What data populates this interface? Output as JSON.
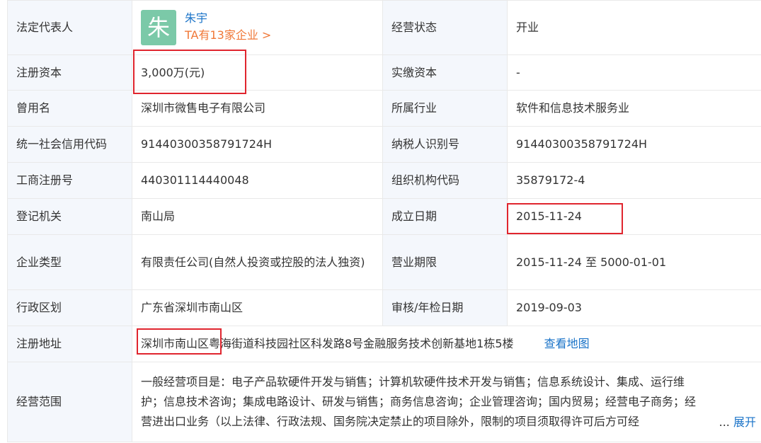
{
  "colors": {
    "label_bg": "#f4f7fc",
    "link_blue": "#1a73c8",
    "orange": "#f07838",
    "avatar_green": "#7bc9a8",
    "highlight_red": "#e0252e"
  },
  "rows": {
    "legal_rep": {
      "label": "法定代表人",
      "avatar_char": "朱",
      "name": "朱宇",
      "companies_link": "TA有13家企业 >"
    },
    "status": {
      "label": "经营状态",
      "value": "开业"
    },
    "reg_capital": {
      "label": "注册资本",
      "value": "3,000万(元)"
    },
    "paid_capital": {
      "label": "实缴资本",
      "value": "-"
    },
    "former_name": {
      "label": "曾用名",
      "value": "深圳市微售电子有限公司"
    },
    "industry": {
      "label": "所属行业",
      "value": "软件和信息技术服务业"
    },
    "credit_code": {
      "label": "统一社会信用代码",
      "value": "91440300358791724H"
    },
    "taxpayer_id": {
      "label": "纳税人识别号",
      "value": "91440300358791724H"
    },
    "biz_reg_no": {
      "label": "工商注册号",
      "value": "440301114440048"
    },
    "org_code": {
      "label": "组织机构代码",
      "value": "35879172-4"
    },
    "authority": {
      "label": "登记机关",
      "value": "南山局"
    },
    "founded": {
      "label": "成立日期",
      "value": "2015-11-24"
    },
    "company_type": {
      "label": "企业类型",
      "value": "有限责任公司(自然人投资或控股的法人独资)"
    },
    "term": {
      "label": "营业期限",
      "value": "2015-11-24 至 5000-01-01"
    },
    "region": {
      "label": "行政区划",
      "value": "广东省深圳市南山区"
    },
    "inspection_date": {
      "label": "审核/年检日期",
      "value": "2019-09-03"
    },
    "address": {
      "label": "注册地址",
      "value": "深圳市南山区粤海街道科技园社区科发路8号金融服务技术创新基地1栋5楼",
      "map_link": "查看地图"
    },
    "scope": {
      "label": "经营范围",
      "value": "一般经营项目是：电子产品软硬件开发与销售；计算机软硬件技术开发与销售；信息系统设计、集成、运行维护；信息技术咨询；集成电路设计、研发与销售；商务信息咨询；企业管理咨询；国内贸易；经营电子商务；经营进出口业务（以上法律、行政法规、国务院决定禁止的项目除外，限制的项目须取得许可后方可经",
      "ellipsis": "...",
      "expand": "展开"
    }
  }
}
